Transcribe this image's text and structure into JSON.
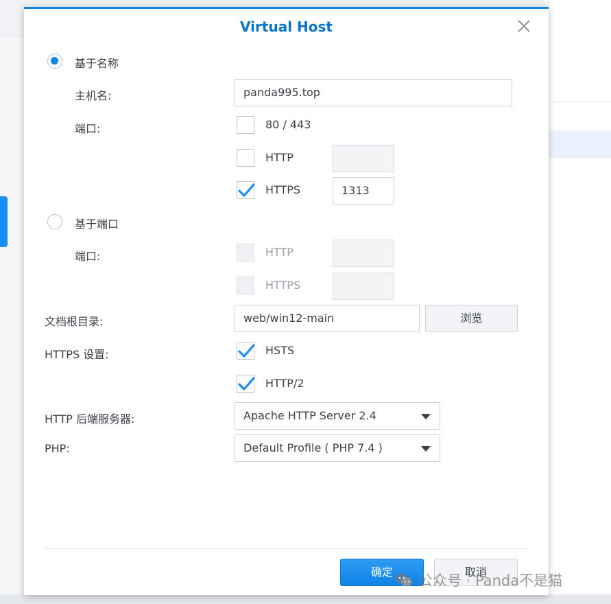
{
  "dialog": {
    "title": "Virtual Host",
    "name_based": {
      "radio_label": "基于名称",
      "selected": true,
      "hostname_label": "主机名:",
      "hostname_value": "panda995.top",
      "port_label": "端口:",
      "options": [
        {
          "label": "80 / 443",
          "checked": false
        },
        {
          "label": "HTTP",
          "checked": false,
          "value": ""
        },
        {
          "label": "HTTPS",
          "checked": true,
          "value": "1313"
        }
      ]
    },
    "port_based": {
      "radio_label": "基于端口",
      "selected": false,
      "port_label": "端口:",
      "options": [
        {
          "label": "HTTP",
          "checked": false,
          "value": ""
        },
        {
          "label": "HTTPS",
          "checked": false,
          "value": ""
        }
      ]
    },
    "doc_root": {
      "label": "文档根目录:",
      "value": "web/win12-main",
      "browse_label": "浏览"
    },
    "https_settings": {
      "label": "HTTPS 设置:",
      "hsts_label": "HSTS",
      "hsts_checked": true,
      "http2_label": "HTTP/2",
      "http2_checked": true
    },
    "backend": {
      "label": "HTTP 后端服务器:",
      "value": "Apache HTTP Server 2.4"
    },
    "php": {
      "label": "PHP:",
      "value": "Default Profile ( PHP 7.4 )"
    },
    "ok_label": "确定",
    "cancel_label": "取消"
  },
  "watermark": {
    "text": "公众号 · Panda不是猫"
  },
  "colors": {
    "accent": "#0f86e6",
    "title": "#0b72c9",
    "check": "#1b8cf2"
  },
  "icons": {
    "close": "close-icon",
    "check": "check-icon",
    "dropdown": "chevron-down-icon",
    "watermark": "wechat-icon"
  }
}
